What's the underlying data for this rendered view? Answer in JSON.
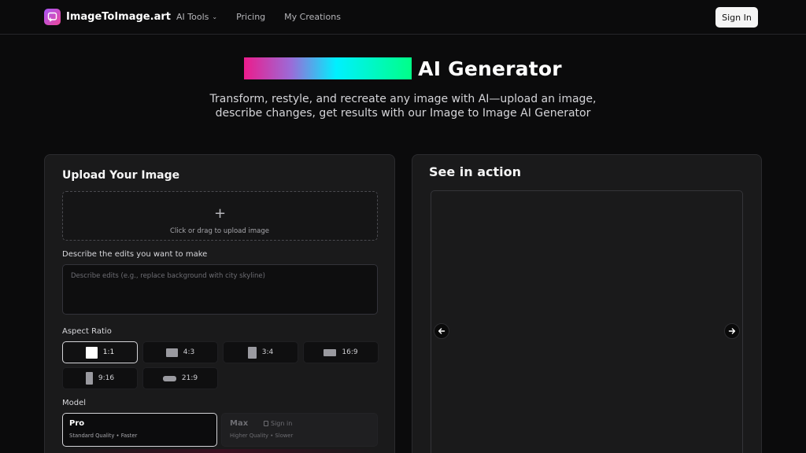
{
  "header": {
    "brand": "ImageToImage.art",
    "nav": [
      {
        "label": "AI Tools",
        "has_dropdown": true
      },
      {
        "label": "Pricing"
      },
      {
        "label": "My Creations"
      }
    ],
    "signin_label": "Sign In"
  },
  "hero": {
    "title": "AI Generator",
    "subtitle_line1": "Transform, restyle, and recreate any image with AI—upload an image,",
    "subtitle_line2": "describe changes, get results with our Image to Image AI Generator"
  },
  "upload_panel": {
    "title": "Upload Your Image",
    "upload_plus": "+",
    "upload_hint": "Click or drag to upload image",
    "edits_label": "Describe the edits you want to make",
    "edits_placeholder": "Describe edits (e.g., replace background with city skyline)",
    "aspect_label": "Aspect Ratio",
    "ratios": [
      {
        "label": "1:1",
        "selected": true
      },
      {
        "label": "4:3",
        "selected": false
      },
      {
        "label": "3:4",
        "selected": false
      },
      {
        "label": "16:9",
        "selected": false
      },
      {
        "label": "9:16",
        "selected": false
      },
      {
        "label": "21:9",
        "selected": false
      }
    ],
    "model_label": "Model",
    "models": [
      {
        "name": "Pro",
        "desc": "Standard Quality • Faster",
        "selected": true
      },
      {
        "name": "Max",
        "lock_label": "Sign in",
        "desc": "Higher Quality • Slower",
        "selected": false
      }
    ]
  },
  "showcase_panel": {
    "title": "See in action"
  },
  "colors": {
    "background": "#0b0b0c",
    "panel": "#1a1a1b",
    "accent_gradient": [
      "#ec1c8c",
      "#9b6bd8",
      "#00f0ff",
      "#00ff88"
    ],
    "brand_gradient": [
      "#a855f7",
      "#ec4899"
    ]
  },
  "icons": {
    "logo": "image-swap-icon",
    "nav_dropdown": "chevron-down-icon",
    "upload": "plus-icon",
    "prev": "arrow-left-icon",
    "next": "arrow-right-icon",
    "lock": "lock-icon"
  }
}
